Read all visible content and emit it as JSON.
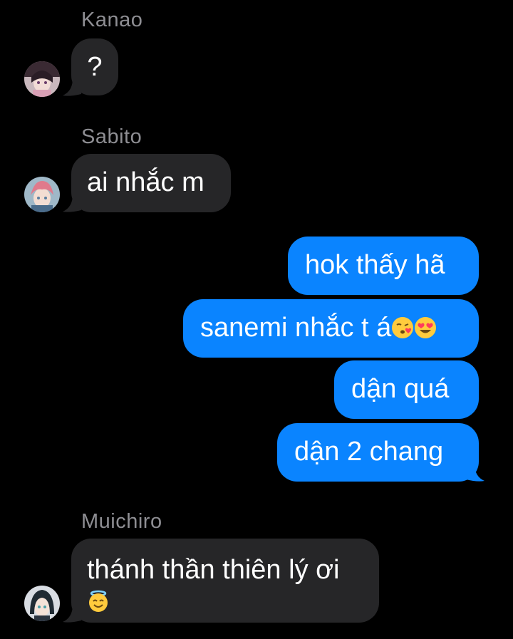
{
  "colors": {
    "background": "#000000",
    "incoming_bubble": "#262628",
    "outgoing_bubble": "#0a84ff",
    "sender_name": "#8e8e93",
    "text": "#ffffff"
  },
  "conversation": {
    "messages": [
      {
        "sender": "Kanao",
        "text": "?",
        "direction": "incoming",
        "avatar": "kanao-avatar"
      },
      {
        "sender": "Sabito",
        "text": "ai nhắc m",
        "direction": "incoming",
        "avatar": "sabito-avatar"
      },
      {
        "text": "hok thấy hã",
        "direction": "outgoing"
      },
      {
        "text": "sanemi nhắc t á",
        "emojis": [
          "kissing-heart-emoji",
          "heart-eyes-emoji"
        ],
        "direction": "outgoing"
      },
      {
        "text": "dận quá",
        "direction": "outgoing"
      },
      {
        "text": "dận 2 chang",
        "direction": "outgoing"
      },
      {
        "sender": "Muichiro",
        "text": "thánh thần thiên lý ơi",
        "emojis": [
          "halo-smile-emoji"
        ],
        "direction": "incoming",
        "avatar": "muichiro-avatar"
      }
    ]
  }
}
